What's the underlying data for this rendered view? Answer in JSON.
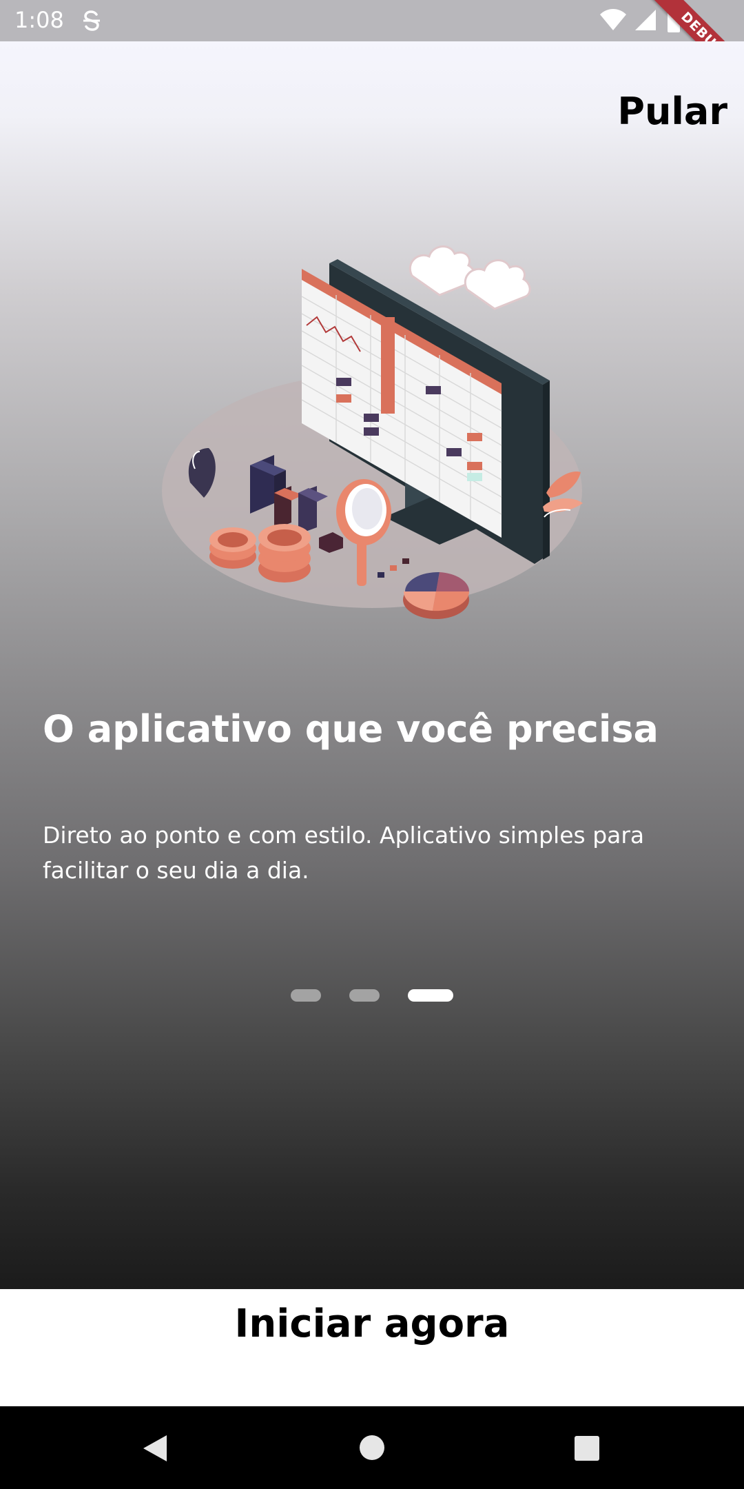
{
  "status_bar": {
    "time": "1:08",
    "icons": [
      "s-app-icon",
      "wifi-icon",
      "signal-icon",
      "battery-icon"
    ]
  },
  "debug_banner": "DEBUG",
  "onboarding": {
    "skip_label": "Pular",
    "illustration": "analytics-dashboard-illustration",
    "title": "O aplicativo que você precisa",
    "description": "Direto ao ponto e com estilo. Aplicativo simples para facilitar o seu dia a dia.",
    "page_indicator": {
      "total": 3,
      "current": 3
    },
    "start_label": "Iniciar agora"
  },
  "colors": {
    "accent": "#e9876d",
    "text_dark": "#000000",
    "text_light": "#ffffff",
    "indicator_active": "#ffffff",
    "indicator_inactive": "#a3a3a3"
  },
  "nav_bar": {
    "icons": [
      "back-icon",
      "home-icon",
      "recents-icon"
    ]
  }
}
